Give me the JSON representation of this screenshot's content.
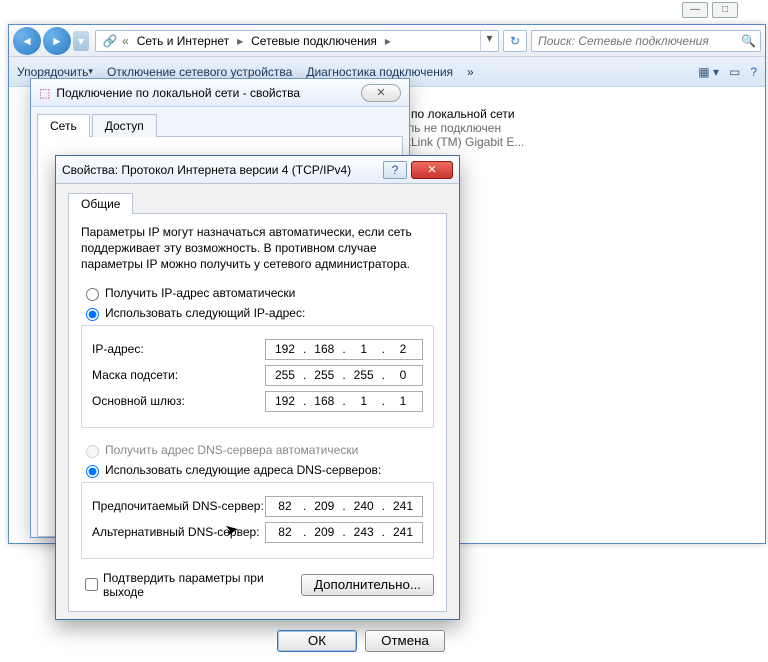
{
  "topctrl": {
    "min": "—",
    "max": "□"
  },
  "explorer": {
    "breadcrumb": [
      "Сеть и Интернет",
      "Сетевые подключения"
    ],
    "search_placeholder": "Поиск: Сетевые подключения",
    "toolbar": {
      "organize": "Упорядочить",
      "disable": "Отключение сетевого устройства",
      "diag": "Диагностика подключения",
      "more": "»"
    },
    "file": {
      "name": "е по локальной сети",
      "sub1": "ель не подключен",
      "sub2": "etLink (TM) Gigabit E..."
    }
  },
  "propwin": {
    "title": "Подключение по локальной сети - свойства",
    "tabs": {
      "net": "Сеть",
      "access": "Доступ"
    }
  },
  "ipdlg": {
    "title": "Свойства: Протокол Интернета версии 4 (TCP/IPv4)",
    "tab_general": "Общие",
    "desc": "Параметры IP могут назначаться автоматически, если сеть поддерживает эту возможность. В противном случае параметры IP можно получить у сетевого администратора.",
    "radio_ip_auto": "Получить IP-адрес автоматически",
    "radio_ip_manual": "Использовать следующий IP-адрес:",
    "label_ip": "IP-адрес:",
    "label_mask": "Маска подсети:",
    "label_gw": "Основной шлюз:",
    "radio_dns_auto": "Получить адрес DNS-сервера автоматически",
    "radio_dns_manual": "Использовать следующие адреса DNS-серверов:",
    "label_dns1": "Предпочитаемый DNS-сервер:",
    "label_dns2": "Альтернативный DNS-сервер:",
    "chk_validate": "Подтвердить параметры при выходе",
    "btn_adv": "Дополнительно...",
    "btn_ok": "ОК",
    "btn_cancel": "Отмена",
    "ip": {
      "a": "192",
      "b": "168",
      "c": "1",
      "d": "2"
    },
    "mask": {
      "a": "255",
      "b": "255",
      "c": "255",
      "d": "0"
    },
    "gw": {
      "a": "192",
      "b": "168",
      "c": "1",
      "d": "1"
    },
    "dns1": {
      "a": "82",
      "b": "209",
      "c": "240",
      "d": "241"
    },
    "dns2": {
      "a": "82",
      "b": "209",
      "c": "243",
      "d": "241"
    }
  }
}
